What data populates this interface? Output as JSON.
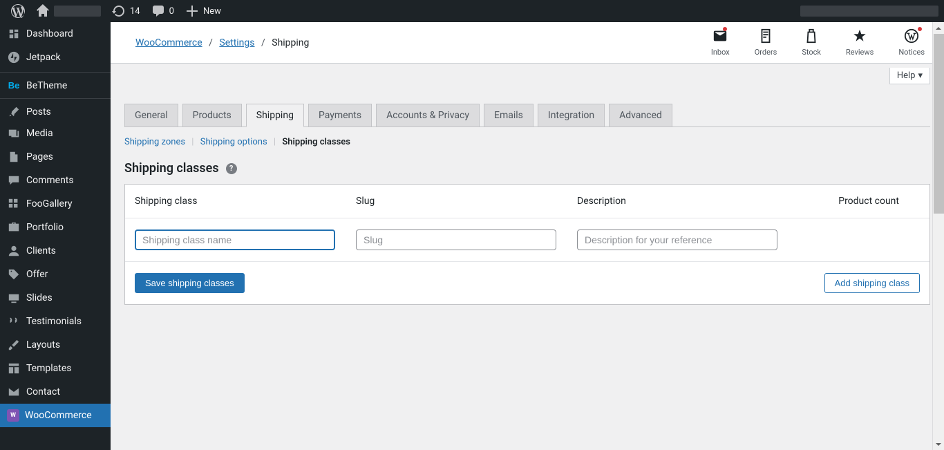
{
  "adminbar": {
    "updates_count": "14",
    "comments_count": "0",
    "new_label": "New"
  },
  "sidebar": {
    "items": [
      {
        "label": "Dashboard"
      },
      {
        "label": "Jetpack"
      },
      {
        "label": "BeTheme"
      },
      {
        "label": "Posts"
      },
      {
        "label": "Media"
      },
      {
        "label": "Pages"
      },
      {
        "label": "Comments"
      },
      {
        "label": "FooGallery"
      },
      {
        "label": "Portfolio"
      },
      {
        "label": "Clients"
      },
      {
        "label": "Offer"
      },
      {
        "label": "Slides"
      },
      {
        "label": "Testimonials"
      },
      {
        "label": "Layouts"
      },
      {
        "label": "Templates"
      },
      {
        "label": "Contact"
      },
      {
        "label": "WooCommerce"
      }
    ]
  },
  "breadcrumb": {
    "a": "WooCommerce",
    "b": "Settings",
    "c": "Shipping"
  },
  "header_icons": {
    "inbox": "Inbox",
    "orders": "Orders",
    "stock": "Stock",
    "reviews": "Reviews",
    "notices": "Notices"
  },
  "help_label": "Help",
  "tabs": [
    "General",
    "Products",
    "Shipping",
    "Payments",
    "Accounts & Privacy",
    "Emails",
    "Integration",
    "Advanced"
  ],
  "active_tab": "Shipping",
  "subsub": {
    "zones": "Shipping zones",
    "options": "Shipping options",
    "classes": "Shipping classes"
  },
  "page_title": "Shipping classes",
  "table": {
    "headers": {
      "class": "Shipping class",
      "slug": "Slug",
      "desc": "Description",
      "count": "Product count"
    },
    "placeholders": {
      "class": "Shipping class name",
      "slug": "Slug",
      "desc": "Description for your reference"
    },
    "save_btn": "Save shipping classes",
    "add_btn": "Add shipping class"
  }
}
